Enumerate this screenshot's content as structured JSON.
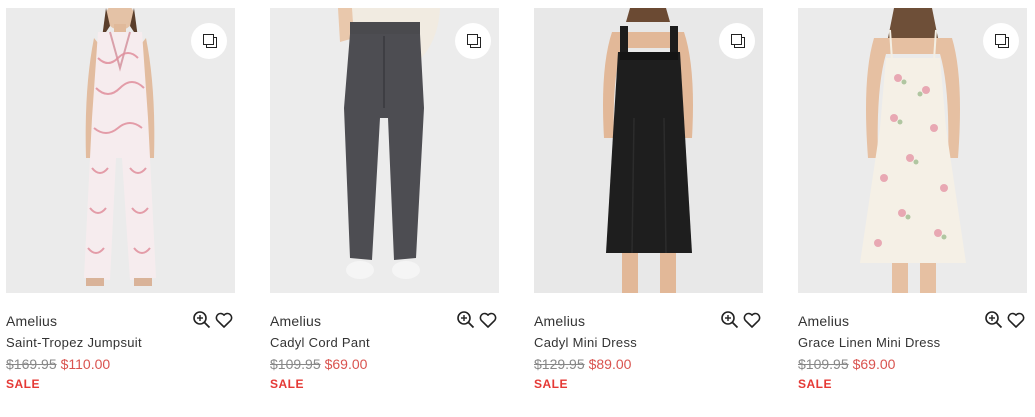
{
  "products": [
    {
      "brand": "Amelius",
      "name": "Saint-Tropez Jumpsuit",
      "original_price": "$169.95",
      "sale_price": "$110.00",
      "badge": "SALE",
      "image": "model-jumpsuit-floral-pink"
    },
    {
      "brand": "Amelius",
      "name": "Cadyl Cord Pant",
      "original_price": "$109.95",
      "sale_price": "$69.00",
      "badge": "SALE",
      "image": "model-charcoal-cord-pants"
    },
    {
      "brand": "Amelius",
      "name": "Cadyl Mini Dress",
      "original_price": "$129.95",
      "sale_price": "$89.00",
      "badge": "SALE",
      "image": "model-black-mini-dress"
    },
    {
      "brand": "Amelius",
      "name": "Grace Linen Mini Dress",
      "original_price": "$109.95",
      "sale_price": "$69.00",
      "badge": "SALE",
      "image": "model-cream-floral-slip-dress"
    }
  ],
  "icons": {
    "quick_view": "quick-view-icon",
    "zoom": "zoom-icon",
    "wishlist": "heart-icon"
  },
  "colors": {
    "sale_price": "#d9534f",
    "sale_badge": "#e53935",
    "original_price": "#888888",
    "image_bg": "#e9e9e9"
  }
}
